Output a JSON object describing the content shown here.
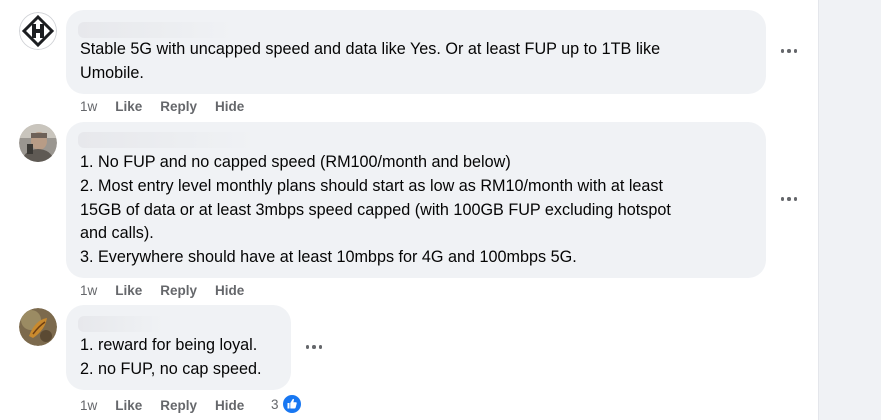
{
  "comments": [
    {
      "author_name": "",
      "lines": [
        "Stable 5G with uncapped speed and data like Yes. Or at least FUP up to 1TB like",
        "Umobile."
      ],
      "time": "1w",
      "like_label": "Like",
      "reply_label": "Reply",
      "hide_label": "Hide"
    },
    {
      "author_name": "",
      "lines": [
        "1. No FUP and no capped speed (RM100/month and below)",
        "2. Most entry level monthly plans should start as low as RM10/month with at least",
        "15GB of data or at least 3mbps speed capped (with 100GB FUP excluding hotspot",
        "and calls).",
        "3. Everywhere should have at least 10mbps for 4G and 100mbps 5G."
      ],
      "time": "1w",
      "like_label": "Like",
      "reply_label": "Reply",
      "hide_label": "Hide"
    },
    {
      "author_name": "",
      "lines": [
        "1. reward for being loyal.",
        "2. no FUP, no cap speed."
      ],
      "time": "1w",
      "like_label": "Like",
      "reply_label": "Reply",
      "hide_label": "Hide",
      "reaction_count": "3",
      "reaction_icon": "like-thumb-icon"
    }
  ],
  "colors": {
    "bubble": "#f0f2f5",
    "meta_text": "#65676b",
    "like_blue": "#1877f2"
  }
}
